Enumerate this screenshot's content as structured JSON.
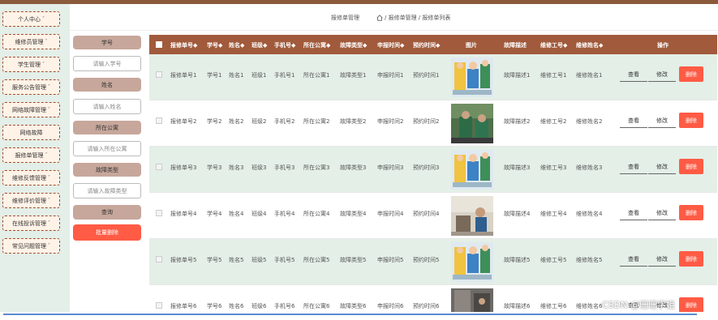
{
  "sidebar": {
    "items": [
      {
        "label": "个人中心"
      },
      {
        "label": "维修员管理"
      },
      {
        "label": "学生管理"
      },
      {
        "label": "服务公告管理"
      },
      {
        "label": "网络故障管理"
      },
      {
        "label": "网络故障"
      },
      {
        "label": "报修单管理"
      },
      {
        "label": "维修反馈管理"
      },
      {
        "label": "维修评价管理"
      },
      {
        "label": "在线投诉管理"
      },
      {
        "label": "常见问题管理"
      }
    ],
    "arrow": "˅"
  },
  "header": {
    "title": "报修单管理",
    "breadcrumb": "/ 报修单管理 / 报修单列表"
  },
  "search": {
    "student_no_label": "学号",
    "student_no_placeholder": "请输入学号",
    "name_label": "姓名",
    "name_placeholder": "请输入姓名",
    "apartment_label": "所在公寓",
    "apartment_placeholder": "请输入所在公寓",
    "fault_type_label": "故障类型",
    "fault_type_placeholder": "请输入故障类型",
    "query_button": "查询",
    "batch_delete_button": "批量删除"
  },
  "table": {
    "columns": [
      "报修单号◆",
      "学号◆",
      "姓名◆",
      "班级◆",
      "手机号◆",
      "所在公寓◆",
      "故障类型◆",
      "申报时间◆",
      "预约时间◆",
      "图片",
      "故障描述",
      "维修工号◆",
      "维修姓名◆",
      "操作"
    ],
    "rows": [
      {
        "no": "报修单号1",
        "sid": "学号1",
        "name": "姓名1",
        "cls": "班级1",
        "phone": "手机号1",
        "apt": "所在公寓1",
        "type": "故障类型1",
        "report": "申报时间1",
        "appt": "预约时间1",
        "desc": "故障描述1",
        "wno": "维修工号1",
        "wname": "维修姓名1",
        "pic": "cartoon"
      },
      {
        "no": "报修单号2",
        "sid": "学号2",
        "name": "姓名2",
        "cls": "班级2",
        "phone": "手机号2",
        "apt": "所在公寓2",
        "type": "故障类型2",
        "report": "申报时间2",
        "appt": "预约时间2",
        "desc": "故障描述2",
        "wno": "维修工号2",
        "wname": "维修姓名2",
        "pic": "photo-green"
      },
      {
        "no": "报修单号3",
        "sid": "学号3",
        "name": "姓名3",
        "cls": "班级3",
        "phone": "手机号3",
        "apt": "所在公寓3",
        "type": "故障类型3",
        "report": "申报时间3",
        "appt": "预约时间3",
        "desc": "故障描述3",
        "wno": "维修工号3",
        "wname": "维修姓名3",
        "pic": "cartoon"
      },
      {
        "no": "报修单号4",
        "sid": "学号4",
        "name": "姓名4",
        "cls": "班级4",
        "phone": "手机号4",
        "apt": "所在公寓4",
        "type": "故障类型4",
        "report": "申报时间4",
        "appt": "预约时间4",
        "desc": "故障描述4",
        "wno": "维修工号4",
        "wname": "维修姓名4",
        "pic": "photo-room"
      },
      {
        "no": "报修单号5",
        "sid": "学号5",
        "name": "姓名5",
        "cls": "班级5",
        "phone": "手机号5",
        "apt": "所在公寓5",
        "type": "故障类型5",
        "report": "申报时间5",
        "appt": "预约时间5",
        "desc": "故障描述5",
        "wno": "维修工号5",
        "wname": "维修姓名5",
        "pic": "cartoon"
      },
      {
        "no": "报修单号6",
        "sid": "学号6",
        "name": "姓名6",
        "cls": "班级6",
        "phone": "手机号6",
        "apt": "所在公寓6",
        "type": "故障类型6",
        "report": "申报时间6",
        "appt": "预约时间6",
        "desc": "故障描述6",
        "wno": "维修工号6",
        "wname": "维修姓名6",
        "pic": "photo-door"
      }
    ],
    "actions": {
      "view": "查看",
      "edit": "修改",
      "delete": "删除"
    }
  },
  "watermark": "CSDN @珊珊学姐",
  "colors": {
    "accent": "#a15a3c",
    "danger": "#ff5b45",
    "sidebar_bg": "#e3efe8",
    "row_alt": "#e4efe7"
  }
}
